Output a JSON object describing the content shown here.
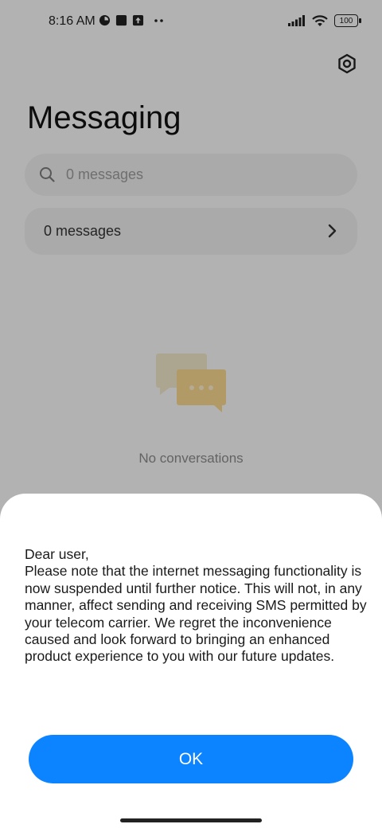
{
  "status_bar": {
    "time": "8:16 AM",
    "battery": "100",
    "left_icons": [
      "data-saver-icon",
      "square-notification-icon",
      "upload-notification-icon",
      "more-dots-icon"
    ],
    "right_icons": [
      "signal-icon",
      "wifi-icon",
      "battery-icon"
    ]
  },
  "header": {
    "title": "Messaging",
    "settings_icon": "settings-hex-icon"
  },
  "search": {
    "placeholder": "0 messages"
  },
  "messages_row": {
    "label": "0 messages"
  },
  "empty_state": {
    "label": "No conversations",
    "icon": "chat-bubbles-icon"
  },
  "dialog": {
    "greeting": "Dear user,",
    "body": "Please note that the internet messaging functionality is now suspended until further notice. This will not, in any manner, affect sending and receiving SMS permitted by your telecom carrier. We regret the inconvenience caused and look forward to bringing an enhanced product experience to you with our future updates.",
    "ok_label": "OK"
  },
  "colors": {
    "accent": "#0d84ff",
    "background": "#f7f7f7",
    "sheet": "#ffffff"
  }
}
